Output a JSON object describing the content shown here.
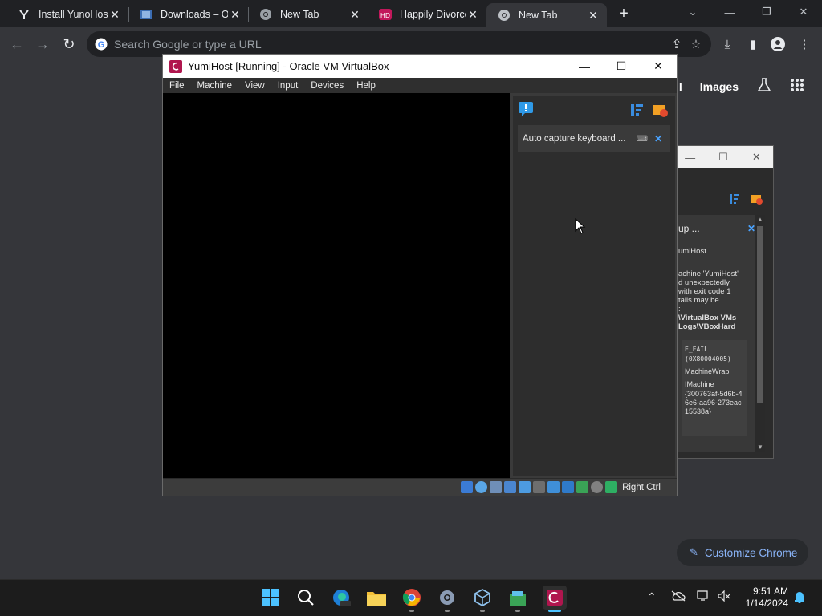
{
  "browser": {
    "tabs": [
      {
        "title": "Install YunoHost",
        "icon": "yunohost-icon"
      },
      {
        "title": "Downloads – Or",
        "icon": "virtualbox-icon"
      },
      {
        "title": "New Tab",
        "icon": "chrome-icon"
      },
      {
        "title": "Happily Divorce",
        "icon": "hd-icon"
      },
      {
        "title": "New Tab",
        "icon": "chrome-icon",
        "active": true
      }
    ],
    "omnibox_placeholder": "Search Google or type a URL",
    "ntp_links": [
      "il",
      "Images"
    ],
    "customize_label": "Customize Chrome"
  },
  "vbox": {
    "title": "YumiHost [Running] - Oracle VM VirtualBox",
    "menu": [
      "File",
      "Machine",
      "View",
      "Input",
      "Devices",
      "Help"
    ],
    "notification": "Auto capture keyboard ...",
    "host_key": "Right Ctrl"
  },
  "bg_vbox": {
    "card_header": "up ...",
    "lines": [
      "umiHost",
      "achine 'YumiHost'",
      "d unexpectedly",
      "with exit code 1",
      "tails may be",
      ":",
      "\\VirtualBox VMs",
      "Logs\\VBoxHard"
    ],
    "code": [
      "E_FAIL",
      "(0X80004005)",
      "MachineWrap",
      "IMachine",
      "{300763af-5d6b-46e6-aa96-273eac15538a}"
    ]
  },
  "taskbar": {
    "time": "9:51 AM",
    "date": "1/14/2024"
  },
  "colors": {
    "accent_blue": "#8ab4f8",
    "vbox_x": "#4aa3ff",
    "taskbar_active": "#4cc2ff"
  }
}
